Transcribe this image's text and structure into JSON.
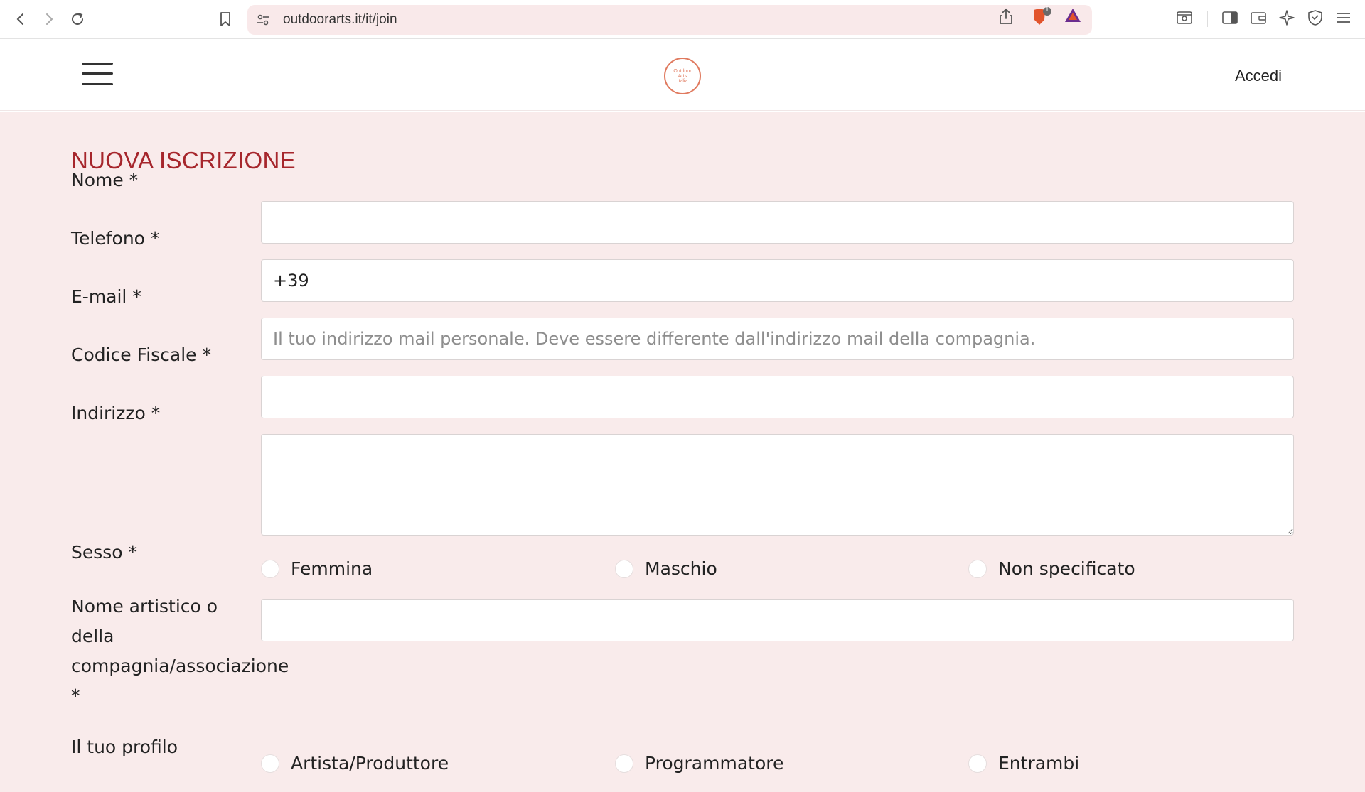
{
  "browser": {
    "url": "outdoorarts.it/it/join",
    "shield_badge": "1"
  },
  "header": {
    "logo_lines": [
      "Outdoor",
      "Arts",
      "Italia"
    ],
    "login_label": "Accedi"
  },
  "form": {
    "title": "NUOVA ISCRIZIONE",
    "fields": {
      "nome": {
        "label": "Nome *",
        "value": "",
        "placeholder": ""
      },
      "telefono": {
        "label": "Telefono *",
        "value": "+39",
        "placeholder": ""
      },
      "email": {
        "label": "E-mail *",
        "value": "",
        "placeholder": "Il tuo indirizzo mail personale. Deve essere differente dall'indirizzo mail della compagnia."
      },
      "codice_fiscale": {
        "label": "Codice Fiscale *",
        "value": "",
        "placeholder": ""
      },
      "indirizzo": {
        "label": "Indirizzo *",
        "value": "",
        "placeholder": ""
      },
      "nome_artistico": {
        "label_lines": [
          "Nome artistico o",
          "della",
          "compagnia/associazione",
          "*"
        ],
        "value": "",
        "placeholder": ""
      }
    },
    "sesso": {
      "label": "Sesso *",
      "options": [
        "Femmina",
        "Maschio",
        "Non specificato"
      ]
    },
    "profilo": {
      "label": "Il tuo profilo",
      "options": [
        "Artista/Produttore",
        "Programmatore",
        "Entrambi"
      ]
    }
  },
  "colors": {
    "accent": "#a6262c",
    "form_bg": "#f9ebeb",
    "logo": "#e07a5f"
  }
}
